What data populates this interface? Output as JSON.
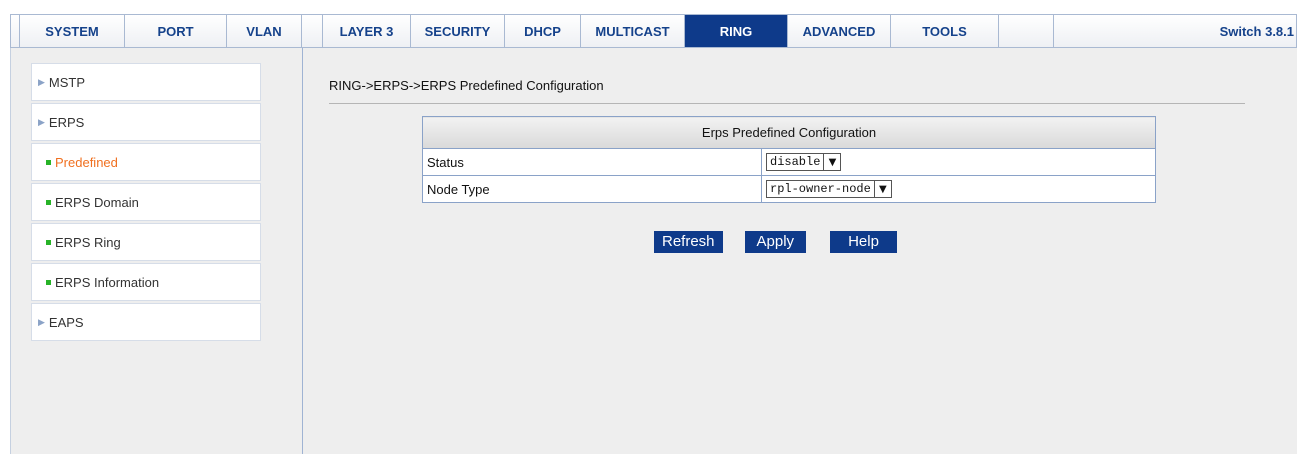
{
  "nav": {
    "tabs": [
      {
        "label": "SYSTEM"
      },
      {
        "label": "PORT"
      },
      {
        "label": "VLAN"
      },
      {
        "label": "LAYER 3"
      },
      {
        "label": "SECURITY"
      },
      {
        "label": "DHCP"
      },
      {
        "label": "MULTICAST"
      },
      {
        "label": "RING"
      },
      {
        "label": "ADVANCED"
      },
      {
        "label": "TOOLS"
      }
    ],
    "active": "RING",
    "version": "Switch 3.8.1"
  },
  "sidebar": {
    "items": [
      {
        "label": "MSTP"
      },
      {
        "label": "ERPS"
      },
      {
        "label": "Predefined"
      },
      {
        "label": "ERPS Domain"
      },
      {
        "label": "ERPS Ring"
      },
      {
        "label": "ERPS Information"
      },
      {
        "label": "EAPS"
      }
    ]
  },
  "main": {
    "breadcrumb": "RING->ERPS->ERPS Predefined Configuration",
    "table": {
      "title": "Erps Predefined Configuration",
      "rows": [
        {
          "label": "Status",
          "value": "disable"
        },
        {
          "label": "Node Type",
          "value": "rpl-owner-node"
        }
      ]
    },
    "buttons": {
      "refresh": "Refresh",
      "apply": "Apply",
      "help": "Help"
    }
  },
  "colors": {
    "accent": "#0e3a8a",
    "selected_menu": "#f07020",
    "bullet": "#27b327"
  }
}
